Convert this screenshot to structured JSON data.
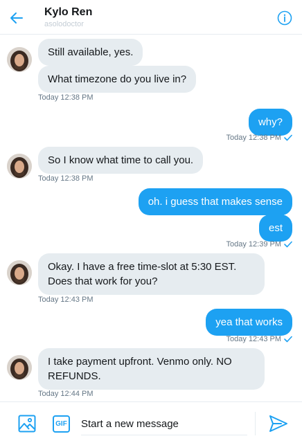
{
  "header": {
    "title": "Kylo Ren",
    "handle": "asolodoctor",
    "back_icon": "arrow-left-icon",
    "info_icon": "info-icon",
    "accent": "#1da1f2"
  },
  "messages": [
    {
      "dir": "in",
      "text": "Still available, yes."
    },
    {
      "dir": "in",
      "text": "What timezone do you live in?"
    },
    {
      "dir": "in-meta",
      "text": "Today 12:38 PM"
    },
    {
      "dir": "out",
      "text": "why?"
    },
    {
      "dir": "out-meta",
      "text": "Today 12:38 PM"
    },
    {
      "dir": "in",
      "text": "So I know what time to call you."
    },
    {
      "dir": "in-meta",
      "text": "Today 12:38 PM"
    },
    {
      "dir": "out",
      "text": "oh. i guess that makes sense"
    },
    {
      "dir": "out",
      "text": "est"
    },
    {
      "dir": "out-meta",
      "text": "Today 12:39 PM"
    },
    {
      "dir": "in",
      "text": "Okay. I have a free time-slot at 5:30 EST. Does that work for you?"
    },
    {
      "dir": "in-meta",
      "text": "Today 12:43 PM"
    },
    {
      "dir": "out",
      "text": "yea that works"
    },
    {
      "dir": "out-meta",
      "text": "Today 12:43 PM"
    },
    {
      "dir": "in",
      "text": "I take payment upfront. Venmo only. NO REFUNDS."
    },
    {
      "dir": "in-meta",
      "text": "Today 12:44 PM"
    }
  ],
  "composer": {
    "placeholder": "Start a new message",
    "gif_label": "GIF",
    "media_icon": "image-icon",
    "send_icon": "send-icon"
  },
  "colors": {
    "outgoing_bubble": "#1da1f2",
    "incoming_bubble": "#e6ecf0",
    "meta_text": "#657786"
  }
}
